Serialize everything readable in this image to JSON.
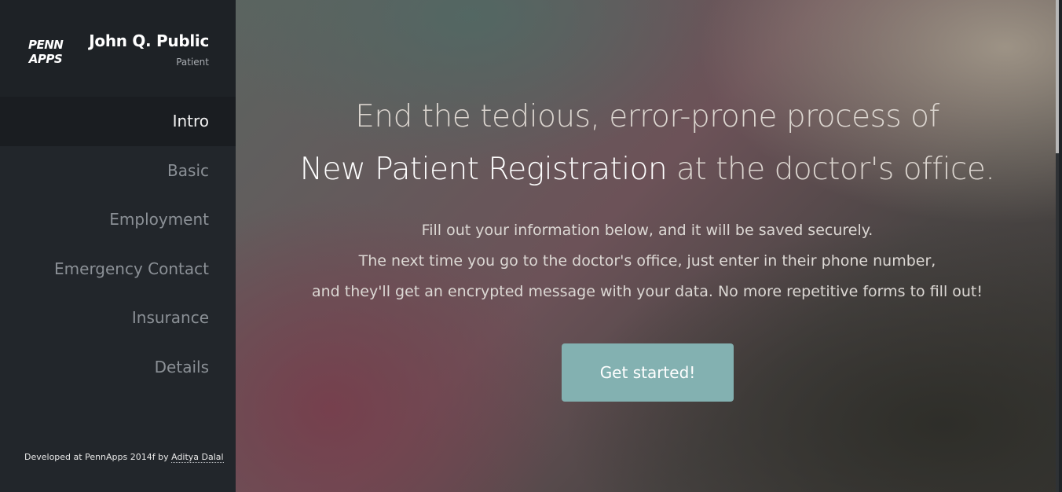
{
  "sidebar": {
    "logo": {
      "line1": "PENN",
      "line2": "APPS"
    },
    "user": {
      "name": "John Q. Public",
      "role": "Patient"
    },
    "nav": [
      {
        "label": "Intro",
        "active": true
      },
      {
        "label": "Basic"
      },
      {
        "label": "Employment"
      },
      {
        "label": "Emergency Contact"
      },
      {
        "label": "Insurance"
      },
      {
        "label": "Details"
      }
    ],
    "footer": {
      "prefix": "Developed at PennApps 2014f by ",
      "author": "Aditya Dalal"
    }
  },
  "main": {
    "headline_line1": "End the tedious, error-prone process of",
    "headline_strong": "New Patient Registration",
    "headline_rest": " at the doctor's office.",
    "paragraphs": [
      "Fill out your information below, and it will be saved securely.",
      "The next time you go to the doctor's office, just enter in their phone number,",
      "and they'll get an encrypted message with your data. No more repetitive forms to fill out!"
    ],
    "cta_label": "Get started!"
  },
  "colors": {
    "sidebar_bg": "#22262b",
    "active_nav_bg": "#1a1d21",
    "cta_bg": "#83b1b1"
  }
}
